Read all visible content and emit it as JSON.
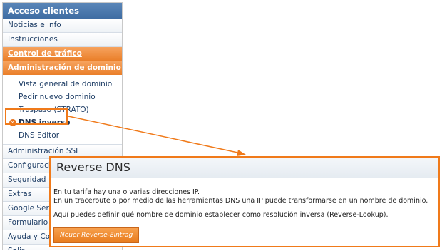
{
  "sidebar": {
    "header": "Acceso clientes",
    "items_top": [
      {
        "label": "Noticias e info"
      },
      {
        "label": "Instrucciones"
      }
    ],
    "traffic": "Control de tráfico",
    "domain_admin": "Administración de dominio",
    "domain_sub": [
      {
        "label": "Vista general de dominio"
      },
      {
        "label": "Pedir nuevo dominio"
      },
      {
        "label": "Traspaso (STRATO)"
      },
      {
        "label": "DNS inverso"
      },
      {
        "label": "DNS Editor"
      }
    ],
    "items_bottom": [
      {
        "label": "Administración SSL"
      },
      {
        "label": "Configuración"
      },
      {
        "label": "Seguridad"
      },
      {
        "label": "Extras"
      },
      {
        "label": "Google Services"
      },
      {
        "label": "Formulario de contacto"
      },
      {
        "label": "Ayuda y Contacto"
      },
      {
        "label": "Salir"
      }
    ],
    "active_bullet": "»"
  },
  "panel": {
    "title": "Reverse DNS",
    "line1": "En tu tarifa hay una o varias direcciones IP.",
    "line2": "En un traceroute o por medio de las herramientas DNS una IP puede transformarse en un nombre de dominio.",
    "line3": "Aquí puedes definir qué nombre de dominio establecer como resolución inversa (Reverse-Lookup).",
    "button": "Neuer Reverse-Eintrag"
  },
  "colors": {
    "accent": "#f07a1a",
    "header_blue": "#4a78ad"
  }
}
